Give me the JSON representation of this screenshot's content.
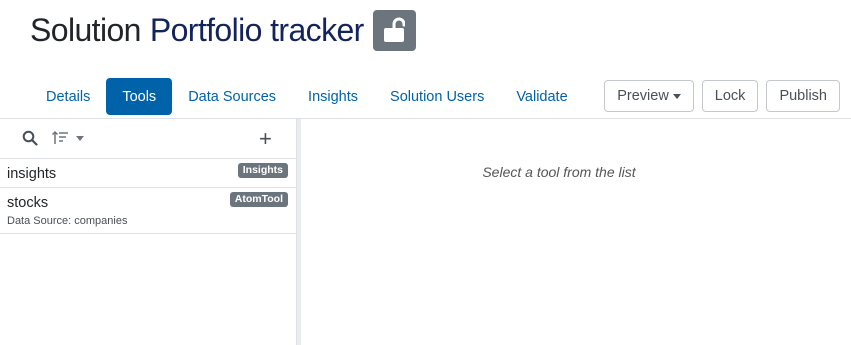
{
  "header": {
    "title_prefix": "Solution",
    "title_name": "Portfolio tracker",
    "lock_icon": "unlock-icon"
  },
  "tabs": [
    {
      "label": "Details",
      "active": false
    },
    {
      "label": "Tools",
      "active": true
    },
    {
      "label": "Data Sources",
      "active": false
    },
    {
      "label": "Insights",
      "active": false
    },
    {
      "label": "Solution Users",
      "active": false
    },
    {
      "label": "Validate",
      "active": false
    }
  ],
  "actions": {
    "preview_label": "Preview",
    "lock_label": "Lock",
    "publish_label": "Publish"
  },
  "toolbar": {
    "search_icon": "search-icon",
    "sort_icon": "sort-icon",
    "add_label": "+"
  },
  "tools": [
    {
      "name": "insights",
      "badge": "Insights",
      "sub": ""
    },
    {
      "name": "stocks",
      "badge": "AtomTool",
      "sub": "Data Source:  companies"
    }
  ],
  "main": {
    "empty_message": "Select a tool from the list"
  },
  "colors": {
    "brand_navy": "#13235b",
    "accent_blue": "#0062a8",
    "badge_gray": "#6c757d"
  }
}
